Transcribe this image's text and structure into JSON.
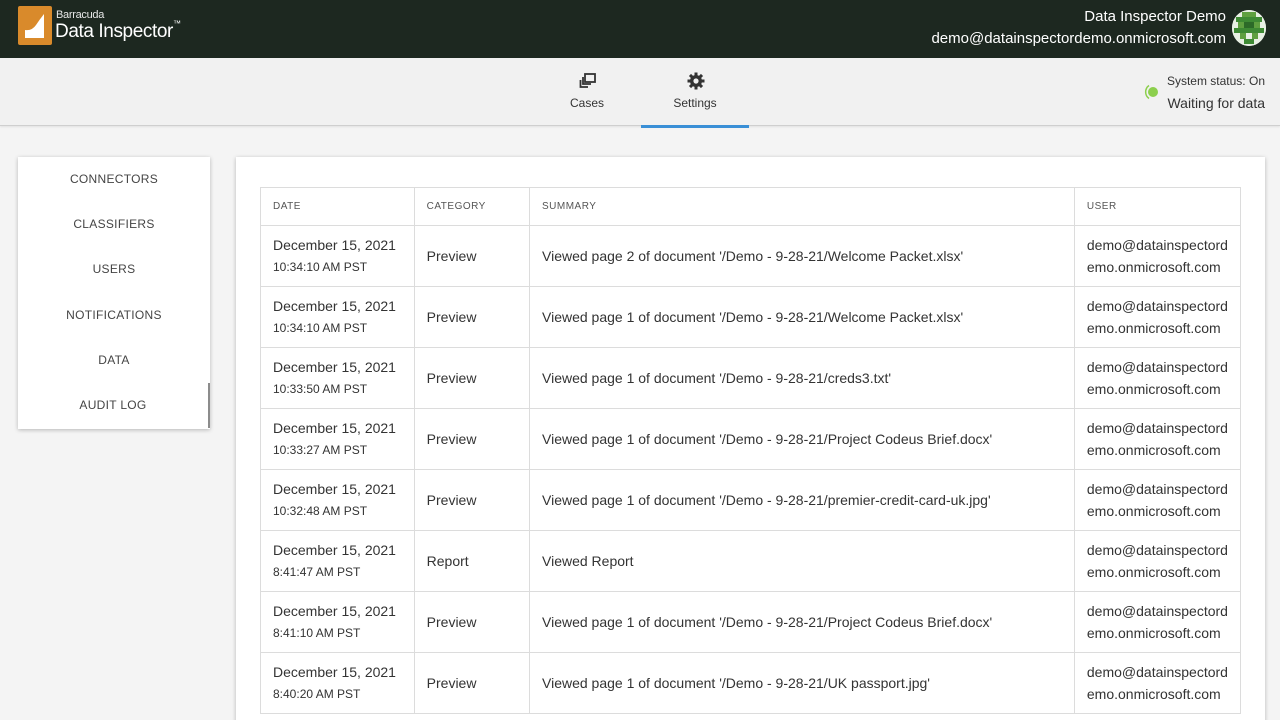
{
  "header": {
    "brand_small": "Barracuda",
    "brand_big": "Data Inspector",
    "brand_tm": "™",
    "account_name": "Data Inspector Demo",
    "account_email": "demo@datainspectordemo.onmicrosoft.com"
  },
  "nav": {
    "tabs": [
      {
        "label": "Cases",
        "icon": "cases-icon",
        "active": false
      },
      {
        "label": "Settings",
        "icon": "gear-icon",
        "active": true
      }
    ],
    "status_label": "System status: On",
    "status_detail": "Waiting for data",
    "status_color": "#8ccf4d"
  },
  "sidebar": {
    "items": [
      {
        "label": "CONNECTORS"
      },
      {
        "label": "CLASSIFIERS"
      },
      {
        "label": "USERS"
      },
      {
        "label": "NOTIFICATIONS"
      },
      {
        "label": "DATA"
      },
      {
        "label": "AUDIT LOG",
        "active": true
      }
    ]
  },
  "audit_log": {
    "columns": [
      "DATE",
      "CATEGORY",
      "SUMMARY",
      "USER"
    ],
    "rows": [
      {
        "date": "December 15, 2021",
        "time": "10:34:10 AM PST",
        "category": "Preview",
        "summary": "Viewed page 2 of document '/Demo - 9-28-21/Welcome Packet.xlsx'",
        "user_1": "demo@datainspectord",
        "user_2": "emo.onmicrosoft.com"
      },
      {
        "date": "December 15, 2021",
        "time": "10:34:10 AM PST",
        "category": "Preview",
        "summary": "Viewed page 1 of document '/Demo - 9-28-21/Welcome Packet.xlsx'",
        "user_1": "demo@datainspectord",
        "user_2": "emo.onmicrosoft.com"
      },
      {
        "date": "December 15, 2021",
        "time": "10:33:50 AM PST",
        "category": "Preview",
        "summary": "Viewed page 1 of document '/Demo - 9-28-21/creds3.txt'",
        "user_1": "demo@datainspectord",
        "user_2": "emo.onmicrosoft.com"
      },
      {
        "date": "December 15, 2021",
        "time": "10:33:27 AM PST",
        "category": "Preview",
        "summary": "Viewed page 1 of document '/Demo - 9-28-21/Project Codeus Brief.docx'",
        "user_1": "demo@datainspectord",
        "user_2": "emo.onmicrosoft.com"
      },
      {
        "date": "December 15, 2021",
        "time": "10:32:48 AM PST",
        "category": "Preview",
        "summary": "Viewed page 1 of document '/Demo - 9-28-21/premier-credit-card-uk.jpg'",
        "user_1": "demo@datainspectord",
        "user_2": "emo.onmicrosoft.com"
      },
      {
        "date": "December 15, 2021",
        "time": "8:41:47 AM PST",
        "category": "Report",
        "summary": "Viewed Report",
        "user_1": "demo@datainspectord",
        "user_2": "emo.onmicrosoft.com"
      },
      {
        "date": "December 15, 2021",
        "time": "8:41:10 AM PST",
        "category": "Preview",
        "summary": "Viewed page 1 of document '/Demo - 9-28-21/Project Codeus Brief.docx'",
        "user_1": "demo@datainspectord",
        "user_2": "emo.onmicrosoft.com"
      },
      {
        "date": "December 15, 2021",
        "time": "8:40:20 AM PST",
        "category": "Preview",
        "summary": "Viewed page 1 of document '/Demo - 9-28-21/UK passport.jpg'",
        "user_1": "demo@datainspectord",
        "user_2": "emo.onmicrosoft.com"
      }
    ]
  },
  "colors": {
    "topbar_bg": "#1d2820",
    "brand_orange": "#d98a2b",
    "active_tab_underline": "#3a8fd6"
  }
}
